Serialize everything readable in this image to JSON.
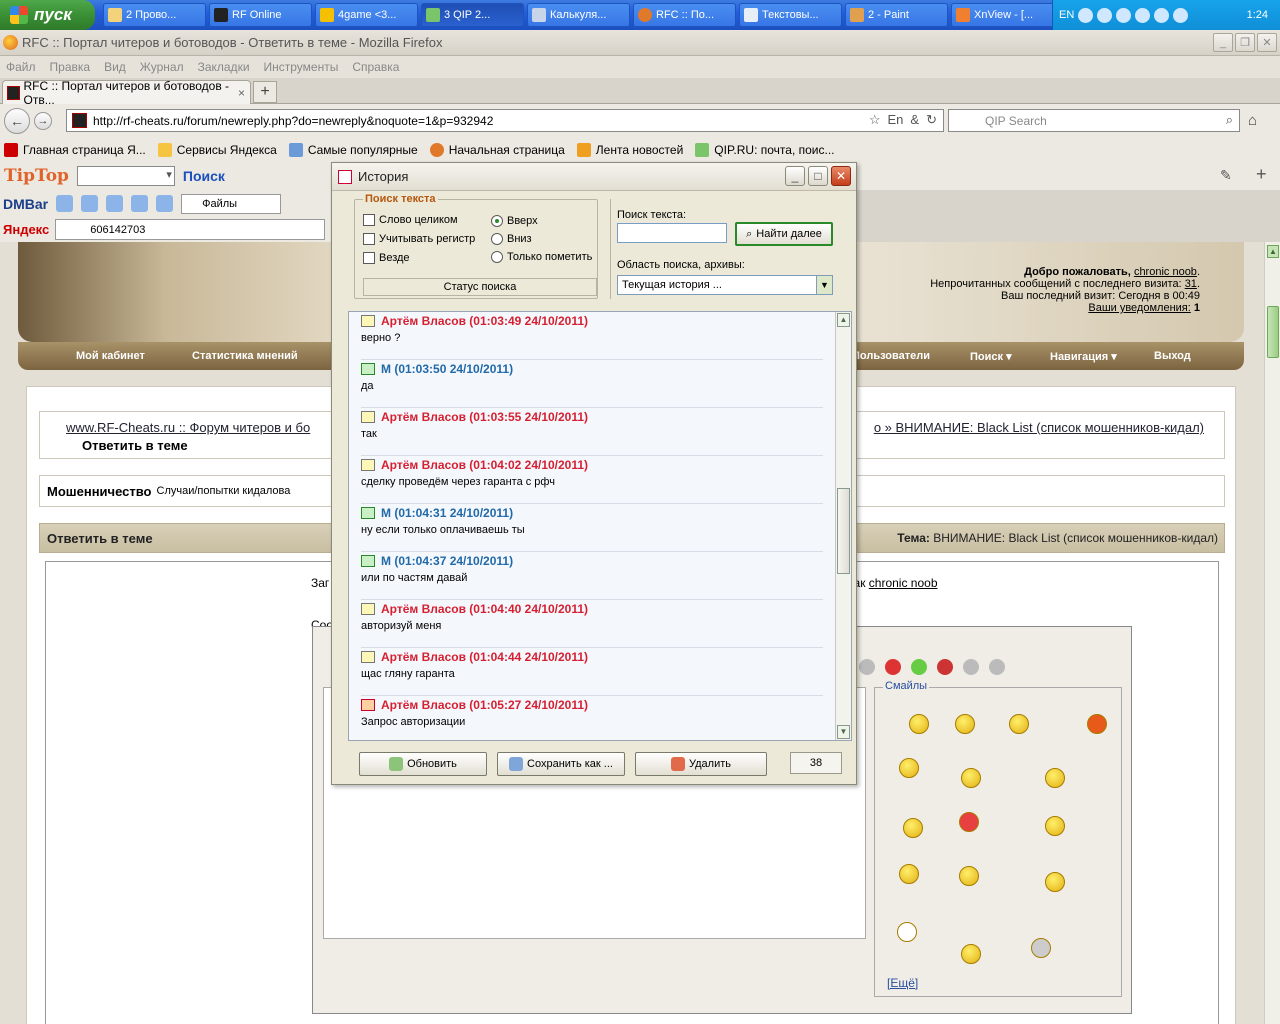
{
  "taskbar": {
    "start_label": "пуск",
    "tasks": [
      {
        "label": "2 Прово..."
      },
      {
        "label": "RF Online"
      },
      {
        "label": "4game <3..."
      },
      {
        "label": "3 QIP 2..."
      },
      {
        "label": "Калькуля..."
      },
      {
        "label": "RFC :: По..."
      },
      {
        "label": "Текстовы..."
      },
      {
        "label": "2 - Paint"
      },
      {
        "label": "XnView - [..."
      }
    ],
    "lang": "EN",
    "clock": "1:24"
  },
  "firefox": {
    "window_title": "RFC :: Портал читеров и ботоводов - Ответить в теме - Mozilla Firefox",
    "menu": [
      "Файл",
      "Правка",
      "Вид",
      "Журнал",
      "Закладки",
      "Инструменты",
      "Справка"
    ],
    "tab_title": "RFC :: Портал читеров и ботоводов - Отв...",
    "url": "http://rf-cheats.ru/forum/newreply.php?do=newreply&noquote=1&p=932942",
    "search_placeholder": "QIP Search",
    "bookmarks": [
      "Главная страница Я...",
      "Сервисы Яндекса",
      "Самые популярные",
      "Начальная страница",
      "Лента новостей",
      "QIP.RU: почта, поис..."
    ],
    "tiptop_logo": "TipTop",
    "poisk": "Поиск",
    "dmbar": "DMBar",
    "files": "Файлы",
    "yandex": "Яндекс",
    "yandex_value": "606142703"
  },
  "forum": {
    "welcome_line1": "Добро пожаловать,",
    "username": "chronic noob",
    "unread_line": "Непрочитанных сообщений с последнего визита:",
    "unread_count": "31",
    "last_visit": "Ваш последний визит: Сегодня в 00:49",
    "notifications_label": "Ваши уведомления:",
    "notifications_count": "1",
    "nav": [
      "Мой кабинет",
      "Статистика мнений",
      "Пользователи",
      "Поиск ▾",
      "Навигация ▾",
      "Выход"
    ],
    "crumb_root": "www.RF-Cheats.ru :: Форум читеров и бо",
    "crumb_tail": "о » ВНИМАНИЕ: Black List (список мошенников-кидал)",
    "crumb_current": "Ответить в теме",
    "section_title": "Мошенничество",
    "section_desc": "Случаи/попытки кидалова",
    "reply_header": "Ответить в теме",
    "topic_label": "Тема:",
    "topic_value": "ВНИМАНИЕ: Black List (список мошенников-кидал)",
    "logged_as_prefix": "как",
    "logged_as_user": "chronic noob",
    "zag_label": "Заг",
    "soo_label": "Соо",
    "smiles_legend": "Смайлы",
    "smiles_more": "[Ещё]"
  },
  "history": {
    "title": "История",
    "group_legend": "Поиск текста",
    "whole_word": "Слово целиком",
    "match_case": "Учитывать регистр",
    "everywhere": "Везде",
    "dir_up": "Вверх",
    "dir_down": "Вниз",
    "only_mark": "Только пометить",
    "status_search": "Статус поиска",
    "search_text_label": "Поиск текста:",
    "find_next": "Найти далее",
    "area_label": "Область поиска, архивы:",
    "area_value": "Текущая история ...",
    "messages": [
      {
        "who": "artem",
        "head": "Артём Власов (01:03:49 24/10/2011)",
        "body": "верно ?"
      },
      {
        "who": "m",
        "head": "М (01:03:50 24/10/2011)",
        "body": "да"
      },
      {
        "who": "artem",
        "head": "Артём Власов (01:03:55 24/10/2011)",
        "body": "так"
      },
      {
        "who": "artem",
        "head": "Артём Власов (01:04:02 24/10/2011)",
        "body": "сделку проведём через гаранта с рфч"
      },
      {
        "who": "m",
        "head": "М (01:04:31 24/10/2011)",
        "body": "ну если только оплачиваешь ты"
      },
      {
        "who": "m",
        "head": "М (01:04:37 24/10/2011)",
        "body": "или по частям давай"
      },
      {
        "who": "artem",
        "head": "Артём Власов (01:04:40 24/10/2011)",
        "body": "авторизуй меня"
      },
      {
        "who": "artem",
        "head": "Артём Власов (01:04:44 24/10/2011)",
        "body": "щас гляну гаранта"
      },
      {
        "who": "auth",
        "head": "Артём Власов (01:05:27 24/10/2011)",
        "body": "Запрос авторизации"
      }
    ],
    "refresh": "Обновить",
    "save_as": "Сохранить как ...",
    "delete": "Удалить",
    "count": "38"
  },
  "colors": {
    "artem": "#d62031",
    "m": "#2169a8",
    "legend": "#b5580e"
  }
}
